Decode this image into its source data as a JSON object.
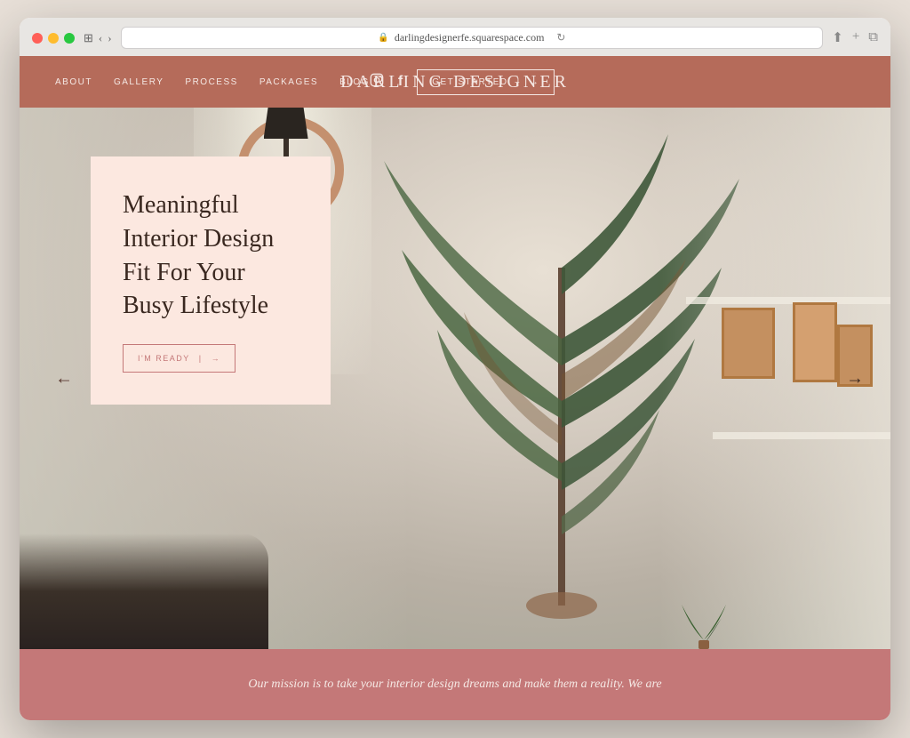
{
  "browser": {
    "url": "darlingdesignerfe.squarespace.com",
    "lock_icon": "🔒",
    "refresh_icon": "↻"
  },
  "nav": {
    "links": [
      "About",
      "Gallery",
      "Process",
      "Packages",
      "Blog"
    ],
    "logo": "Darling Designer",
    "instagram_icon": "IG",
    "facebook_icon": "f",
    "cta_label": "Get Started",
    "cta_arrow": "→"
  },
  "hero": {
    "heading_line1": "Meaningful",
    "heading_line2": "Interior Design",
    "heading_line3": "Fit For Your",
    "heading_line4": "Busy Lifestyle",
    "cta_label": "I'm Ready",
    "cta_arrow": "→",
    "nav_arrow_left": "←",
    "nav_arrow_right": "→"
  },
  "bottom": {
    "text": "Our mission is to take your interior design dreams and make them a reality. We are"
  },
  "colors": {
    "nav_bg": "#b56b5a",
    "hero_card_bg": "#fce8e0",
    "bottom_bg": "#c47878",
    "text_dark": "#3a2820",
    "text_light": "#f5e8e4",
    "accent": "#c47878"
  }
}
